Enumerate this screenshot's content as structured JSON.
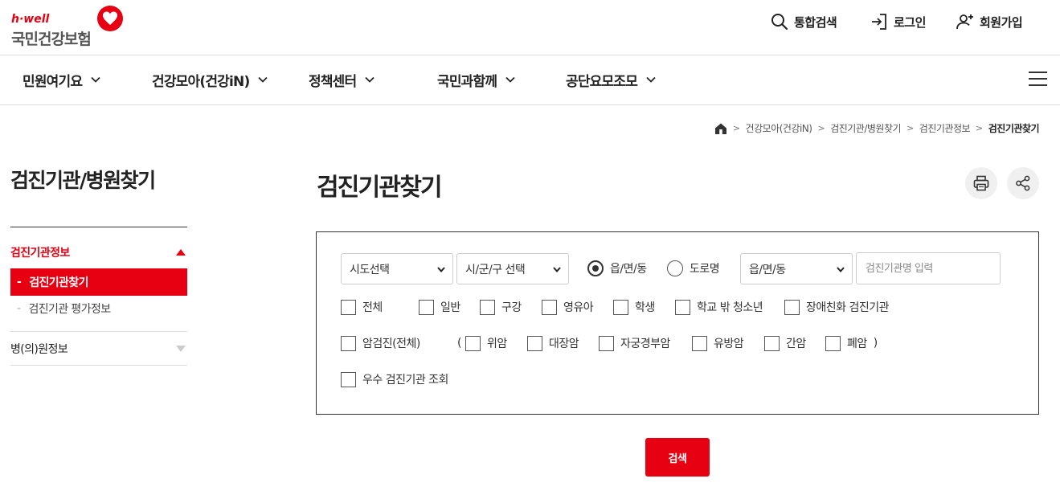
{
  "header": {
    "logo_brand": "h·well",
    "logo_name": "국민건강보험",
    "utils": [
      {
        "label": "통합검색",
        "icon": "search-icon"
      },
      {
        "label": "로그인",
        "icon": "login-icon"
      },
      {
        "label": "회원가입",
        "icon": "user-add-icon"
      }
    ]
  },
  "gnb": [
    {
      "label": "민원여기요"
    },
    {
      "label": "건강모아(건강iN)"
    },
    {
      "label": "정책센터"
    },
    {
      "label": "국민과함께"
    },
    {
      "label": "공단요모조모"
    }
  ],
  "breadcrumb": [
    "건강모아(건강iN)",
    "검진기관/병원찾기",
    "검진기관정보",
    "검진기관찾기"
  ],
  "lnb": {
    "title": "검진기관/병원찾기",
    "groups": [
      {
        "label": "검진기관정보",
        "expanded": true
      },
      {
        "label": "병(의)원정보",
        "expanded": false
      }
    ],
    "items": [
      {
        "label": "검진기관찾기",
        "active": true
      },
      {
        "label": "검진기관 평가정보",
        "active": false
      }
    ],
    "bullet": "-"
  },
  "main": {
    "title": "검진기관찾기",
    "actions": [
      {
        "icon": "print-icon"
      },
      {
        "icon": "share-icon"
      }
    ]
  },
  "search": {
    "sido": "시도선택",
    "sigungu": "시/군/구 선택",
    "radios": [
      {
        "label": "읍/면/동",
        "checked": true
      },
      {
        "label": "도로명",
        "checked": false
      }
    ],
    "dong": "읍/면/동",
    "name_placeholder": "검진기관명 입력",
    "types": [
      "전체",
      "일반",
      "구강",
      "영유아",
      "학생",
      "학교 밖 청소년",
      "장애친화 검진기관"
    ],
    "cancer_all": "암검진(전체)",
    "paren_open": "(",
    "paren_close": ")",
    "cancers": [
      "위암",
      "대장암",
      "자궁경부암",
      "유방암",
      "간암",
      "폐암"
    ],
    "excellent": "우수 검진기관 조회",
    "submit": "검색"
  },
  "colors": {
    "accent": "#e60012"
  }
}
